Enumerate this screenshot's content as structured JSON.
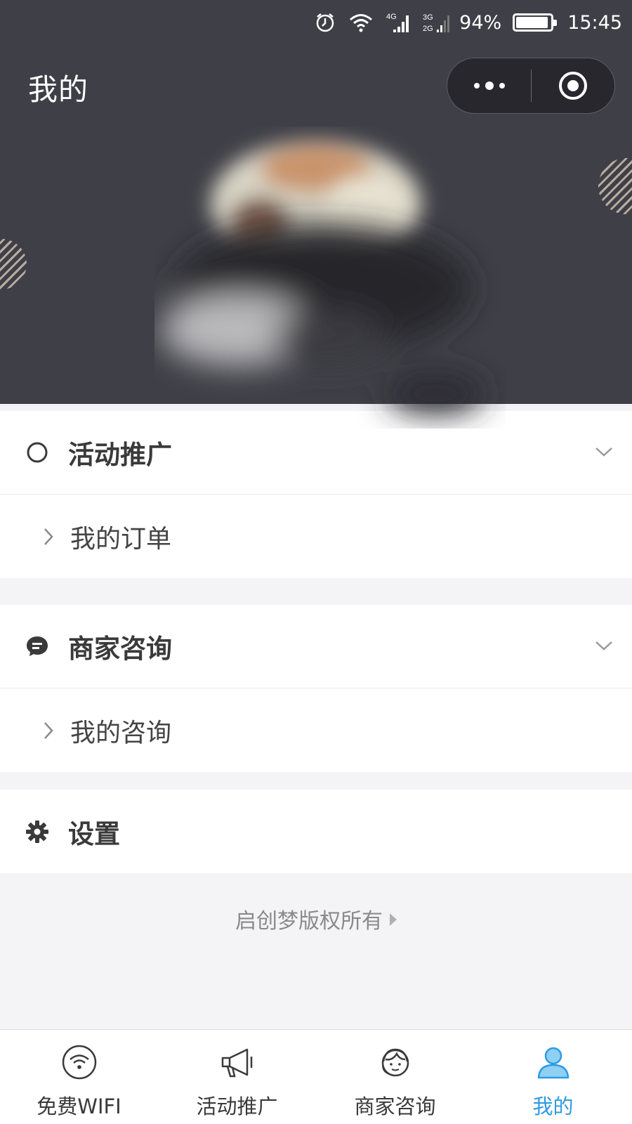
{
  "status_bar": {
    "network_1": "4G",
    "network_2": "3G",
    "network_3": "2G",
    "battery_percent": "94%",
    "battery_level": 0.94,
    "time": "15:45",
    "icons": [
      "alarm-icon",
      "wifi-icon",
      "signal-4g-icon",
      "signal-3g-2g-icon",
      "battery-icon"
    ]
  },
  "header": {
    "title": "我的"
  },
  "sections": {
    "activity": {
      "title": "活动推广",
      "icon": "circle-icon",
      "items": [
        {
          "label": "我的订单"
        }
      ]
    },
    "consult": {
      "title": "商家咨询",
      "icon": "chat-bubble-icon",
      "items": [
        {
          "label": "我的咨询"
        }
      ]
    },
    "settings": {
      "title": "设置",
      "icon": "gear-icon"
    }
  },
  "footer": {
    "copyright": "启创梦版权所有"
  },
  "tabbar": {
    "active_color": "#2f9be2",
    "tabs": [
      {
        "label": "免费WIFI",
        "icon": "wifi-circle-icon",
        "active": false
      },
      {
        "label": "活动推广",
        "icon": "megaphone-icon",
        "active": false
      },
      {
        "label": "商家咨询",
        "icon": "customer-service-icon",
        "active": false
      },
      {
        "label": "我的",
        "icon": "user-icon",
        "active": true
      }
    ]
  },
  "colors": {
    "header_bg": "#3f3f47",
    "page_bg": "#f4f3f6",
    "accent": "#2f9be2"
  }
}
